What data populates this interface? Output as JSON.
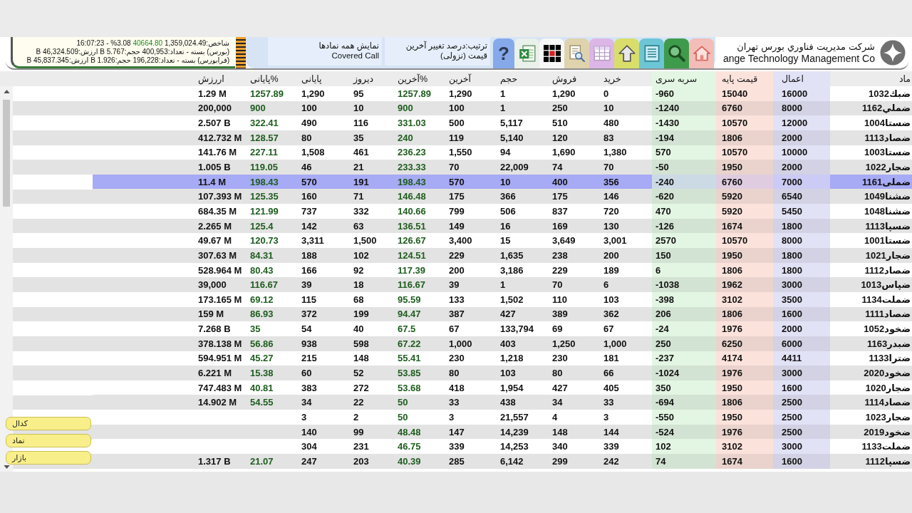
{
  "toolbar": {
    "company": [
      "شرکت مدیریت فناوري بورس تهران",
      "ange Technology Management Co"
    ],
    "tools": [
      {
        "kind": "home"
      },
      {
        "kind": "search"
      },
      {
        "kind": "list"
      },
      {
        "kind": "up"
      },
      {
        "kind": "table"
      },
      {
        "kind": "preview"
      },
      {
        "kind": "grid"
      },
      {
        "kind": "excel"
      },
      {
        "kind": "help",
        "label": "?"
      }
    ],
    "sort": [
      "ترتیب:درصد تغییر آخرین",
      "قیمت (نزولی)"
    ],
    "filter": [
      "نمایش همه نمادها",
      "Covered Call"
    ],
    "market": {
      "index": {
        "total": "شاخص:1,359,024.49",
        "points": "40664.80",
        "change": "%3.08 - 16:07:23"
      },
      "exchanges": [
        {
          "status": "(بورس) بسته -",
          "stats": [
            "تعداد:400,953",
            "حجم:5.767 B",
            "ارزش:46,324.509 B"
          ]
        },
        {
          "status": "(فرابورس) بسته -",
          "stats": [
            "تعداد:196,228",
            "حجم:1.926 B",
            "ارزش:45,837.345 B"
          ]
        }
      ]
    }
  },
  "table": {
    "columns": [
      {
        "label": "اررزش",
        "kind": "number"
      },
      {
        "label": "پایانی%",
        "kind": "percent"
      },
      {
        "label": "پایانی",
        "kind": "number"
      },
      {
        "label": "دیروز",
        "kind": "number"
      },
      {
        "label": "آخرین%",
        "kind": "percent"
      },
      {
        "label": "آخرین",
        "kind": "number"
      },
      {
        "label": "حجم",
        "kind": "number"
      },
      {
        "label": "فروش",
        "kind": "number"
      },
      {
        "label": "خرید",
        "kind": "number"
      },
      {
        "label": "سربه سری",
        "kind": "number",
        "color": "#e3f5e3"
      },
      {
        "label": "قیمت پایه",
        "kind": "number",
        "color": "#fbe3dc"
      },
      {
        "label": "اعمال",
        "kind": "number",
        "color": "#e2e2f6"
      },
      {
        "label": "ماد",
        "kind": "symbol"
      }
    ],
    "rows": [
      {
        "selected": false,
        "cells": [
          "1.29 M",
          "1257.89",
          "1,290",
          "95",
          "1257.89",
          "1,290",
          "1",
          "1,290",
          "0",
          "-960",
          "15040",
          "16000",
          "ضبك1032"
        ]
      },
      {
        "selected": false,
        "cells": [
          "200,000",
          "900",
          "100",
          "10",
          "900",
          "100",
          "1",
          "250",
          "10",
          "-1240",
          "6760",
          "8000",
          "ضملي1162"
        ]
      },
      {
        "selected": false,
        "cells": [
          "2.507 B",
          "322.41",
          "490",
          "116",
          "331.03",
          "500",
          "5,117",
          "510",
          "480",
          "-1430",
          "10570",
          "12000",
          "ضستا1004"
        ]
      },
      {
        "selected": false,
        "cells": [
          "412.732 M",
          "128.57",
          "80",
          "35",
          "240",
          "119",
          "5,140",
          "120",
          "83",
          "-194",
          "1806",
          "2000",
          "ضصاد1113"
        ]
      },
      {
        "selected": false,
        "cells": [
          "141.76 M",
          "227.11",
          "1,508",
          "461",
          "236.23",
          "1,550",
          "94",
          "1,690",
          "1,380",
          "570",
          "10570",
          "10000",
          "ضستا1003"
        ]
      },
      {
        "selected": false,
        "cells": [
          "1.005 B",
          "119.05",
          "46",
          "21",
          "233.33",
          "70",
          "22,009",
          "74",
          "70",
          "-50",
          "1950",
          "2000",
          "ضجار1022"
        ]
      },
      {
        "selected": true,
        "cells": [
          "11.4 M",
          "198.43",
          "570",
          "191",
          "198.43",
          "570",
          "10",
          "400",
          "356",
          "-240",
          "6760",
          "7000",
          "ضملی1161"
        ]
      },
      {
        "selected": false,
        "cells": [
          "107.393 M",
          "125.35",
          "160",
          "71",
          "146.48",
          "175",
          "366",
          "175",
          "146",
          "-620",
          "5920",
          "6540",
          "ضشنا1049"
        ]
      },
      {
        "selected": false,
        "cells": [
          "684.35 M",
          "121.99",
          "737",
          "332",
          "140.66",
          "799",
          "506",
          "837",
          "720",
          "470",
          "5920",
          "5450",
          "ضشنا1048"
        ]
      },
      {
        "selected": false,
        "cells": [
          "2.265 M",
          "125.4",
          "142",
          "63",
          "136.51",
          "149",
          "16",
          "169",
          "130",
          "-126",
          "1674",
          "1800",
          "ضسپا1113"
        ]
      },
      {
        "selected": false,
        "cells": [
          "49.67 M",
          "120.73",
          "3,311",
          "1,500",
          "126.67",
          "3,400",
          "15",
          "3,649",
          "3,001",
          "2570",
          "10570",
          "8000",
          "ضستا1001"
        ]
      },
      {
        "selected": false,
        "cells": [
          "307.63 M",
          "84.31",
          "188",
          "102",
          "124.51",
          "229",
          "1,635",
          "238",
          "200",
          "150",
          "1950",
          "1800",
          "ضجار1021"
        ]
      },
      {
        "selected": false,
        "cells": [
          "528.964 M",
          "80.43",
          "166",
          "92",
          "117.39",
          "200",
          "3,186",
          "229",
          "189",
          "6",
          "1806",
          "1800",
          "ضصاد1112"
        ]
      },
      {
        "selected": false,
        "cells": [
          "39,000",
          "116.67",
          "39",
          "18",
          "116.67",
          "39",
          "1",
          "70",
          "6",
          "-1038",
          "1962",
          "3000",
          "ضپاس1013"
        ]
      },
      {
        "selected": false,
        "cells": [
          "173.165 M",
          "69.12",
          "115",
          "68",
          "95.59",
          "133",
          "1,502",
          "110",
          "103",
          "-398",
          "3102",
          "3500",
          "ضملت1134"
        ]
      },
      {
        "selected": false,
        "cells": [
          "159 M",
          "86.93",
          "372",
          "199",
          "94.47",
          "387",
          "427",
          "389",
          "362",
          "206",
          "1806",
          "1600",
          "ضصاد1111"
        ]
      },
      {
        "selected": false,
        "cells": [
          "7.268 B",
          "35",
          "54",
          "40",
          "67.5",
          "67",
          "133,794",
          "69",
          "67",
          "-24",
          "1976",
          "2000",
          "ضخود1052"
        ]
      },
      {
        "selected": false,
        "cells": [
          "378.138 M",
          "56.86",
          "938",
          "598",
          "67.22",
          "1,000",
          "403",
          "1,250",
          "1,000",
          "250",
          "6250",
          "6000",
          "ضبدر1163"
        ]
      },
      {
        "selected": false,
        "cells": [
          "594.951 M",
          "45.27",
          "215",
          "148",
          "55.41",
          "230",
          "1,218",
          "230",
          "181",
          "-237",
          "4174",
          "4411",
          "ضترا1133"
        ]
      },
      {
        "selected": false,
        "cells": [
          "6.221 M",
          "15.38",
          "60",
          "52",
          "53.85",
          "80",
          "103",
          "80",
          "66",
          "-1024",
          "1976",
          "3000",
          "ضخود2020"
        ]
      },
      {
        "selected": false,
        "cells": [
          "747.483 M",
          "40.81",
          "383",
          "272",
          "53.68",
          "418",
          "1,954",
          "427",
          "405",
          "350",
          "1950",
          "1600",
          "ضجار1020"
        ]
      },
      {
        "selected": false,
        "cells": [
          "14.902 M",
          "54.55",
          "34",
          "22",
          "50",
          "33",
          "438",
          "34",
          "33",
          "-694",
          "1806",
          "2500",
          "ضصاد1114"
        ]
      },
      {
        "selected": false,
        "cells": [
          null,
          null,
          "3",
          "2",
          "50",
          "3",
          "21,557",
          "4",
          "3",
          "-550",
          "1950",
          "2500",
          "ضجار1023"
        ]
      },
      {
        "selected": false,
        "cells": [
          null,
          null,
          "140",
          "99",
          "48.48",
          "147",
          "14,239",
          "148",
          "144",
          "-524",
          "1976",
          "2500",
          "ضخود2019"
        ]
      },
      {
        "selected": false,
        "cells": [
          null,
          null,
          "304",
          "231",
          "46.75",
          "339",
          "14,253",
          "340",
          "339",
          "102",
          "3102",
          "3000",
          "ضملت1133"
        ]
      },
      {
        "selected": false,
        "cells": [
          "1.317 B",
          "21.07",
          "247",
          "203",
          "40.39",
          "285",
          "6,142",
          "299",
          "242",
          "74",
          "1674",
          "1600",
          "ضسپا1112"
        ]
      }
    ]
  },
  "shortcut_buttons": [
    {
      "label": "کدال"
    },
    {
      "label": "نماد"
    },
    {
      "label": "بازار"
    }
  ]
}
